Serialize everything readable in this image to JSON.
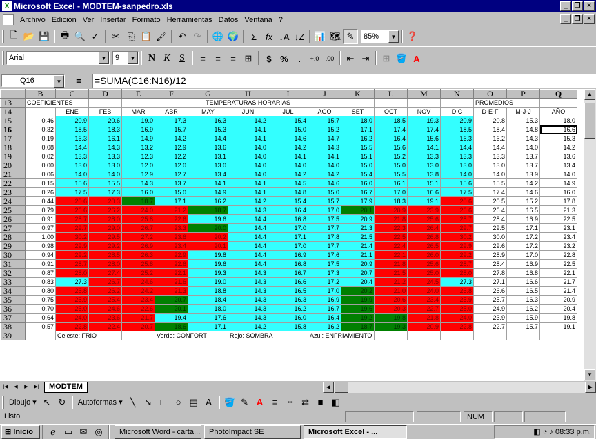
{
  "window": {
    "title": "Microsoft Excel - MODTEM-sanpedro.xls"
  },
  "menu": [
    "Archivo",
    "Edición",
    "Ver",
    "Insertar",
    "Formato",
    "Herramientas",
    "Datos",
    "Ventana",
    "?"
  ],
  "toolbar": {
    "zoom": "85%",
    "font_name": "Arial",
    "font_size": "9"
  },
  "formula_bar": {
    "cell_ref": "Q16",
    "eq": "=",
    "formula": "=SUMA(C16:N16)/12"
  },
  "columns": [
    "B",
    "C",
    "D",
    "E",
    "F",
    "G",
    "H",
    "I",
    "J",
    "K",
    "L",
    "M",
    "N",
    "O",
    "P",
    "Q"
  ],
  "header_rows": {
    "r13": {
      "num": "13",
      "coef": "COEFICIENTES",
      "temps": "TEMPERATURAS HORARIAS",
      "prom": "PROMEDIOS"
    },
    "r14": {
      "num": "14",
      "cells": [
        "ENE",
        "FEB",
        "MAR",
        "ABR",
        "MAY",
        "JUN",
        "JUL",
        "AGO",
        "SET",
        "OCT",
        "NOV",
        "DIC",
        "D-E-F",
        "M-J-J",
        "AÑO"
      ]
    }
  },
  "rows": [
    {
      "num": "15",
      "coef": "0.46",
      "temps": [
        "20.9",
        "20.6",
        "19.0",
        "17.3",
        "16.3",
        "14.2",
        "15.4",
        "15.7",
        "18.0",
        "18.5",
        "19.3",
        "20.9"
      ],
      "colors": "cccccccccccc",
      "prom": [
        "20.8",
        "15.3",
        "18.0"
      ]
    },
    {
      "num": "16",
      "coef": "0.32",
      "temps": [
        "18.5",
        "18.3",
        "16.9",
        "15.7",
        "15.3",
        "14.1",
        "15.0",
        "15.2",
        "17.1",
        "17.4",
        "17.4",
        "18.5"
      ],
      "colors": "cccccccccccc",
      "prom": [
        "18.4",
        "14.8",
        "16.6"
      ]
    },
    {
      "num": "17",
      "coef": "0.19",
      "temps": [
        "16.3",
        "16.1",
        "14.9",
        "14.2",
        "14.4",
        "14.1",
        "14.6",
        "14.7",
        "16.2",
        "16.4",
        "15.6",
        "16.3"
      ],
      "colors": "cccccccccccc",
      "prom": [
        "16.2",
        "14.3",
        "15.3"
      ]
    },
    {
      "num": "18",
      "coef": "0.08",
      "temps": [
        "14.4",
        "14.3",
        "13.2",
        "12.9",
        "13.6",
        "14.0",
        "14.2",
        "14.3",
        "15.5",
        "15.6",
        "14.1",
        "14.4"
      ],
      "colors": "cccccccccccc",
      "prom": [
        "14.4",
        "14.0",
        "14.2"
      ]
    },
    {
      "num": "19",
      "coef": "0.02",
      "temps": [
        "13.3",
        "13.3",
        "12.3",
        "12.2",
        "13.1",
        "14.0",
        "14.1",
        "14.1",
        "15.1",
        "15.2",
        "13.3",
        "13.3"
      ],
      "colors": "cccccccccccc",
      "prom": [
        "13.3",
        "13.7",
        "13.6"
      ]
    },
    {
      "num": "20",
      "coef": "0.00",
      "temps": [
        "13.0",
        "13.0",
        "12.0",
        "12.0",
        "13.0",
        "14.0",
        "14.0",
        "14.0",
        "15.0",
        "15.0",
        "13.0",
        "13.0"
      ],
      "colors": "cccccccccccc",
      "prom": [
        "13.0",
        "13.7",
        "13.4"
      ]
    },
    {
      "num": "21",
      "coef": "0.06",
      "temps": [
        "14.0",
        "14.0",
        "12.9",
        "12.7",
        "13.4",
        "14.0",
        "14.2",
        "14.2",
        "15.4",
        "15.5",
        "13.8",
        "14.0"
      ],
      "colors": "cccccccccccc",
      "prom": [
        "14.0",
        "13.9",
        "14.0"
      ]
    },
    {
      "num": "22",
      "coef": "0.15",
      "temps": [
        "15.6",
        "15.5",
        "14.3",
        "13.7",
        "14.1",
        "14.1",
        "14.5",
        "14.6",
        "16.0",
        "16.1",
        "15.1",
        "15.6"
      ],
      "colors": "cccccccccccc",
      "prom": [
        "15.5",
        "14.2",
        "14.9"
      ]
    },
    {
      "num": "23",
      "coef": "0.26",
      "temps": [
        "17.5",
        "17.3",
        "16.0",
        "15.0",
        "14.9",
        "14.1",
        "14.8",
        "15.0",
        "16.7",
        "17.0",
        "16.6",
        "17.5"
      ],
      "colors": "cccccccccccc",
      "prom": [
        "17.4",
        "14.6",
        "16.0"
      ]
    },
    {
      "num": "24",
      "coef": "0.44",
      "temps": [
        "20.6",
        "20.3",
        "18.7",
        "17.1",
        "16.2",
        "14.2",
        "15.4",
        "15.7",
        "17.9",
        "18.3",
        "19.1",
        "20.6"
      ],
      "colors": "rrgccccccccr",
      "prom": [
        "20.5",
        "15.2",
        "17.8"
      ]
    },
    {
      "num": "25",
      "coef": "0.79",
      "temps": [
        "26.6",
        "26.2",
        "24.0",
        "21.2",
        "18.7",
        "14.3",
        "16.4",
        "17.0",
        "20.1",
        "20.9",
        "23.9",
        "26.6"
      ],
      "colors": "rrrrgcccgrrr",
      "prom": [
        "26.4",
        "16.5",
        "21.3"
      ]
    },
    {
      "num": "26",
      "coef": "0.91",
      "temps": [
        "28.7",
        "28.0",
        "25.8",
        "22.6",
        "19.6",
        "14.4",
        "16.8",
        "17.5",
        "20.9",
        "21.8",
        "25.6",
        "28.7"
      ],
      "colors": "rrrrcccccrrr",
      "prom": [
        "28.4",
        "16.9",
        "22.5"
      ]
    },
    {
      "num": "27",
      "coef": "0.97",
      "temps": [
        "29.7",
        "29.0",
        "26.7",
        "23.3",
        "20.0",
        "14.4",
        "17.0",
        "17.7",
        "21.3",
        "22.3",
        "26.4",
        "29.7"
      ],
      "colors": "rrrrgccccrrr",
      "prom": [
        "29.5",
        "17.1",
        "23.1"
      ]
    },
    {
      "num": "28",
      "coef": "1.00",
      "temps": [
        "30.2",
        "29.5",
        "27.2",
        "23.6",
        "20.2",
        "14.4",
        "17.1",
        "17.8",
        "21.5",
        "22.5",
        "26.8",
        "30.2"
      ],
      "colors": "rrrrrccccrrr",
      "prom": [
        "30.0",
        "17.2",
        "23.4"
      ]
    },
    {
      "num": "29",
      "coef": "0.98",
      "temps": [
        "29.9",
        "29.2",
        "26.9",
        "23.4",
        "20.1",
        "14.4",
        "17.0",
        "17.7",
        "21.4",
        "22.4",
        "26.5",
        "29.9"
      ],
      "colors": "rrrrrccccrrr",
      "prom": [
        "29.6",
        "17.2",
        "23.2"
      ]
    },
    {
      "num": "30",
      "coef": "0.94",
      "temps": [
        "29.2",
        "28.5",
        "26.3",
        "22.9",
        "19.8",
        "14.4",
        "16.9",
        "17.6",
        "21.1",
        "22.1",
        "26.0",
        "29.2"
      ],
      "colors": "rrrrcccccrrr",
      "prom": [
        "28.9",
        "17.0",
        "22.8"
      ]
    },
    {
      "num": "31",
      "coef": "0.91",
      "temps": [
        "28.7",
        "28.0",
        "25.8",
        "22.6",
        "19.6",
        "14.4",
        "16.8",
        "17.5",
        "20.9",
        "21.8",
        "25.6",
        "28.7"
      ],
      "colors": "rrrrcccccrrr",
      "prom": [
        "28.4",
        "16.9",
        "22.5"
      ]
    },
    {
      "num": "32",
      "coef": "0.87",
      "temps": [
        "28.0",
        "27.4",
        "25.2",
        "22.1",
        "19.3",
        "14.3",
        "16.7",
        "17.3",
        "20.7",
        "21.5",
        "25.0",
        "28.0"
      ],
      "colors": "rrrrcccccrrr",
      "prom": [
        "27.8",
        "16.8",
        "22.1"
      ]
    },
    {
      "num": "33",
      "coef": "0.83",
      "temps": [
        "27.3",
        "26.7",
        "24.6",
        "21.6",
        "19.0",
        "14.3",
        "16.6",
        "17.2",
        "20.4",
        "21.2",
        "24.5",
        "27.3"
      ],
      "colors": "crrrcccccrrc",
      "prom": [
        "27.1",
        "16.6",
        "21.7"
      ]
    },
    {
      "num": "34",
      "coef": "0.80",
      "temps": [
        "26.8",
        "26.2",
        "24.2",
        "21.3",
        "18.8",
        "14.3",
        "16.5",
        "17.0",
        "20.2",
        "21.0",
        "24.0",
        "26.8"
      ],
      "colors": "rrrrccccgrrr",
      "prom": [
        "26.6",
        "16.5",
        "21.4"
      ]
    },
    {
      "num": "35",
      "coef": "0.75",
      "temps": [
        "25.9",
        "25.4",
        "23.4",
        "20.7",
        "18.4",
        "14.3",
        "16.3",
        "16.9",
        "19.9",
        "20.6",
        "23.4",
        "25.9"
      ],
      "colors": "rrrgccccgrrr",
      "prom": [
        "25.7",
        "16.3",
        "20.9"
      ]
    },
    {
      "num": "36",
      "coef": "0.70",
      "temps": [
        "25.0",
        "24.6",
        "22.6",
        "20.1",
        "18.0",
        "14.3",
        "16.2",
        "16.7",
        "19.6",
        "20.3",
        "22.7",
        "25.0"
      ],
      "colors": "rrrgccccgrrr",
      "prom": [
        "24.9",
        "16.2",
        "20.4"
      ]
    },
    {
      "num": "37",
      "coef": "0.64",
      "temps": [
        "24.0",
        "23.6",
        "21.7",
        "19.4",
        "17.6",
        "14.3",
        "16.0",
        "16.4",
        "19.2",
        "19.8",
        "21.8",
        "24.0"
      ],
      "colors": "rrrcccccggrr",
      "prom": [
        "23.9",
        "15.9",
        "19.8"
      ]
    },
    {
      "num": "38",
      "coef": "0.57",
      "temps": [
        "22.8",
        "22.4",
        "20.7",
        "18.6",
        "17.1",
        "14.2",
        "15.8",
        "16.2",
        "18.7",
        "19.3",
        "20.9",
        "22.8"
      ],
      "colors": "rrrgccccggrr",
      "prom": [
        "22.7",
        "15.7",
        "19.1"
      ]
    }
  ],
  "legend_row": {
    "num": "39",
    "celeste": "Celeste: FRIO",
    "verde": "Verde: CONFORT",
    "rojo": "Rojo: SOMBRA",
    "azul": "Azul: ENFRIAMIENTO"
  },
  "selected": {
    "row": "16",
    "col": "Q"
  },
  "sheet_tab": "MODTEM",
  "drawing_bar": {
    "dibujo": "Dibujo",
    "autoformas": "Autoformas"
  },
  "status": {
    "text": "Listo",
    "num": "NUM"
  },
  "taskbar": {
    "start": "Inicio",
    "tasks": [
      "Microsoft Word - carta...",
      "PhotoImpact SE",
      "Microsoft Excel - ..."
    ],
    "clock": "08:33 p.m."
  },
  "colors": {
    "celeste": "#33ffff",
    "rojo": "#ff0000",
    "verde": "#008000",
    "titlebar": "#000080"
  }
}
